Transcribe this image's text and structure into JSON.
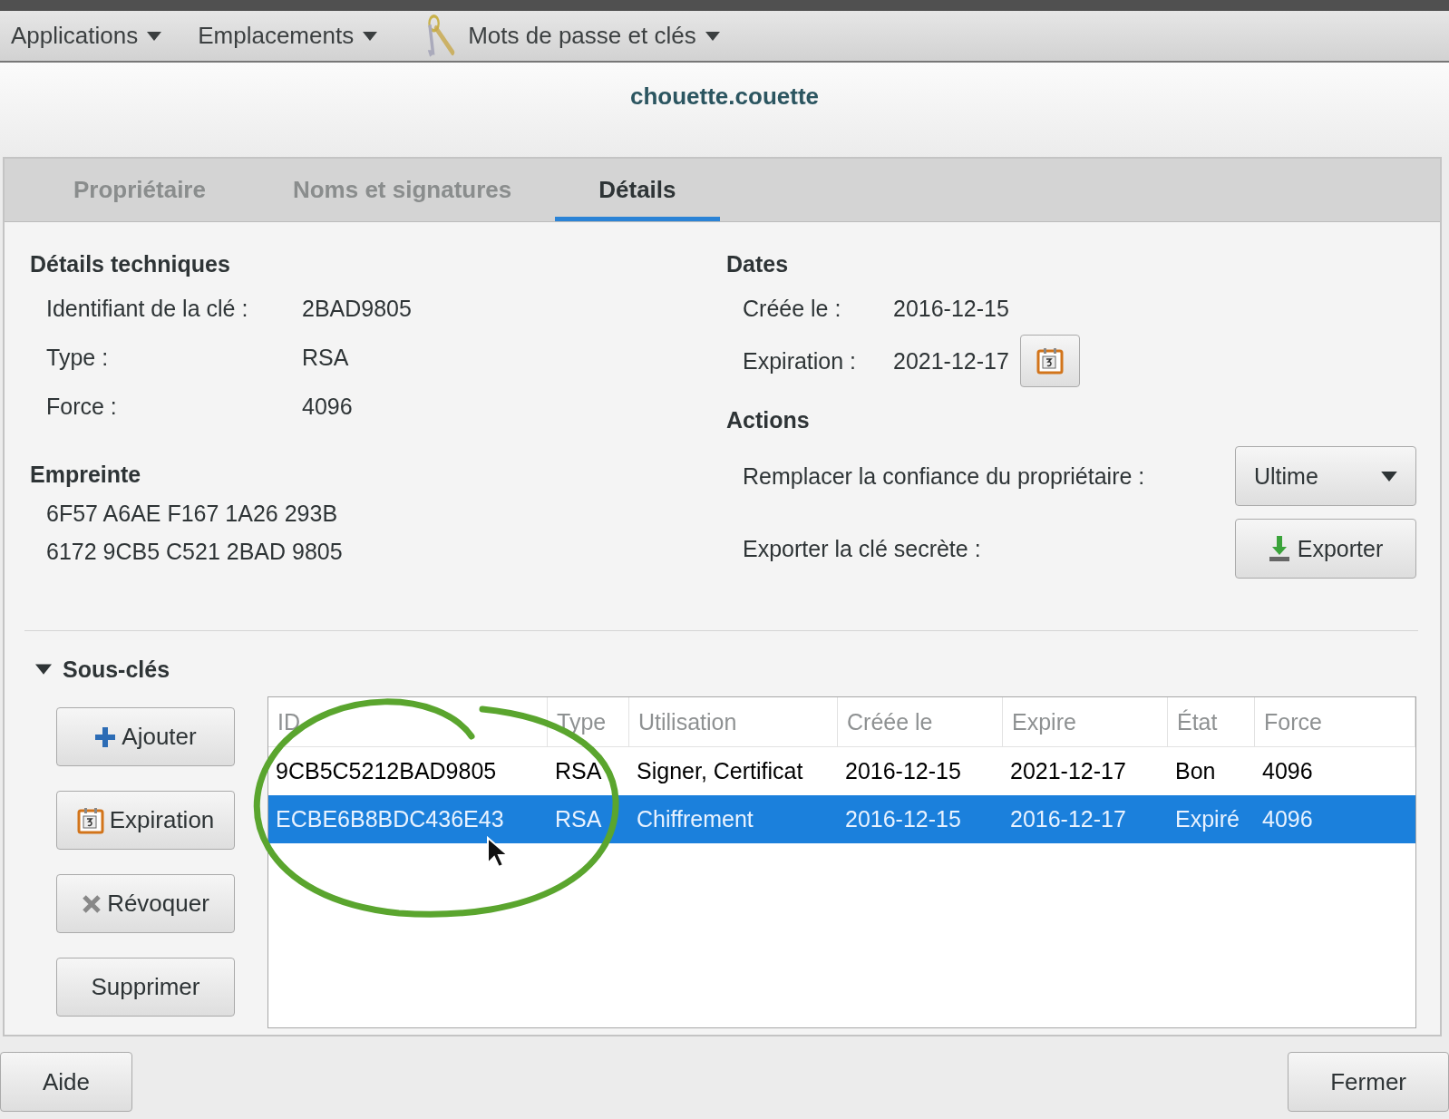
{
  "top_bar": {
    "menus": [
      {
        "label": "Applications",
        "kind": "plain"
      },
      {
        "label": "Emplacements",
        "kind": "plain"
      },
      {
        "label": "Mots de passe et clés",
        "kind": "app"
      }
    ]
  },
  "window": {
    "title": "chouette.couette"
  },
  "tabs": [
    {
      "label": "Propriétaire",
      "selected": false
    },
    {
      "label": "Noms et signatures",
      "selected": false
    },
    {
      "label": "Détails",
      "selected": true
    }
  ],
  "technical": {
    "heading": "Détails techniques",
    "rows": [
      {
        "label": "Identifiant de la clé :",
        "value": "2BAD9805"
      },
      {
        "label": "Type :",
        "value": "RSA"
      },
      {
        "label": "Force :",
        "value": "4096"
      }
    ]
  },
  "fingerprint": {
    "heading": "Empreinte",
    "lines": [
      "6F57 A6AE F167 1A26 293B",
      "6172 9CB5 C521 2BAD 9805"
    ]
  },
  "dates": {
    "heading": "Dates",
    "rows": [
      {
        "label": "Créée le :",
        "value": "2016-12-15",
        "kind": "plain"
      },
      {
        "label": "Expiration :",
        "value": "2021-12-17",
        "kind": "editable"
      }
    ]
  },
  "actions": {
    "heading": "Actions",
    "rows": [
      {
        "label": "Remplacer la confiance du propriétaire :",
        "kind": "dropdown",
        "value": "Ultime"
      },
      {
        "label": "Exporter la clé secrète :",
        "kind": "button",
        "value": "Exporter"
      }
    ]
  },
  "subkeys": {
    "heading": "Sous-clés",
    "expanded": true,
    "buttons": [
      {
        "label": "Ajouter",
        "kind": "add"
      },
      {
        "label": "Expiration",
        "kind": "calendar"
      },
      {
        "label": "Révoquer",
        "kind": "revoke"
      },
      {
        "label": "Supprimer",
        "kind": "plain"
      }
    ],
    "columns": [
      "ID",
      "Type",
      "Utilisation",
      "Créée le",
      "Expire",
      "État",
      "Force"
    ],
    "rows": [
      {
        "cells": [
          "9CB5C5212BAD9805",
          "RSA",
          "Signer, Certificat",
          "2016-12-15",
          "2021-12-17",
          "Bon",
          "4096"
        ],
        "selected": false
      },
      {
        "cells": [
          "ECBE6B8BDC436E43",
          "RSA",
          "Chiffrement",
          "2016-12-15",
          "2016-12-17",
          "Expiré",
          "4096"
        ],
        "selected": true
      }
    ]
  },
  "footer": {
    "buttons": [
      "Aide",
      "Fermer"
    ]
  }
}
